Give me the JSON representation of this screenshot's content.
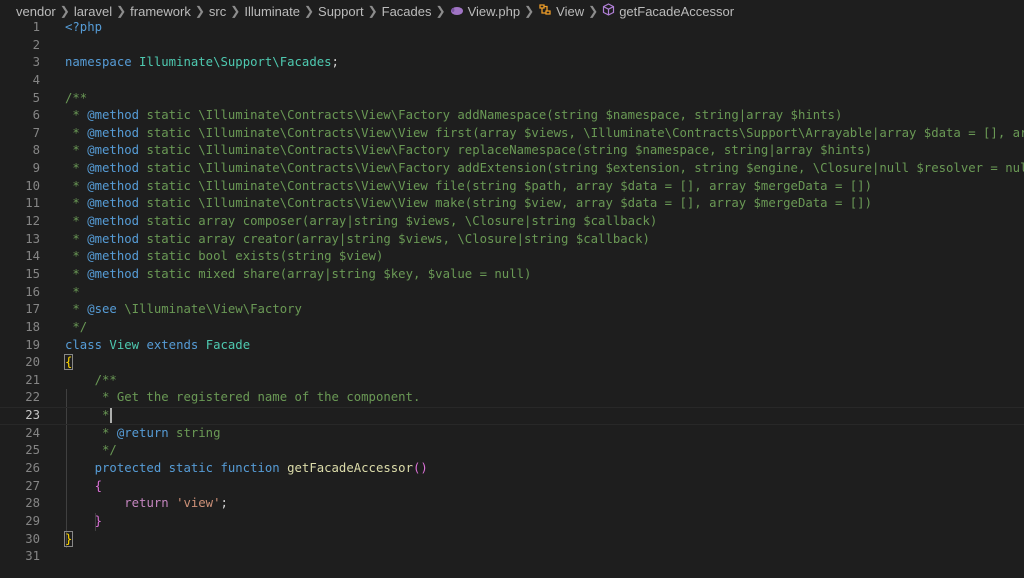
{
  "breadcrumb": {
    "items": [
      "vendor",
      "laravel",
      "framework",
      "src",
      "Illuminate",
      "Support",
      "Facades",
      "View.php",
      "View",
      "getFacadeAccessor"
    ],
    "separator": ">"
  },
  "editor": {
    "current_line": 23,
    "lines": [
      {
        "n": "1",
        "tokens": [
          {
            "t": "<?php",
            "c": "t-tag"
          }
        ]
      },
      {
        "n": "2",
        "tokens": []
      },
      {
        "n": "3",
        "tokens": [
          {
            "t": "namespace ",
            "c": "t-kw"
          },
          {
            "t": "Illuminate\\Support\\Facades",
            "c": "t-ns"
          },
          {
            "t": ";",
            "c": "t-pnc"
          }
        ]
      },
      {
        "n": "4",
        "tokens": []
      },
      {
        "n": "5",
        "tokens": [
          {
            "t": "/**",
            "c": "t-cmt"
          }
        ]
      },
      {
        "n": "6",
        "tokens": [
          {
            "t": " * ",
            "c": "t-cmt"
          },
          {
            "t": "@method",
            "c": "t-kw"
          },
          {
            "t": " static \\Illuminate\\Contracts\\View\\Factory addNamespace(string $namespace, string|array $hints)",
            "c": "t-cmt"
          }
        ]
      },
      {
        "n": "7",
        "tokens": [
          {
            "t": " * ",
            "c": "t-cmt"
          },
          {
            "t": "@method",
            "c": "t-kw"
          },
          {
            "t": " static \\Illuminate\\Contracts\\View\\View first(array $views, \\Illuminate\\Contracts\\Support\\Arrayable|array $data = [], array",
            "c": "t-cmt"
          }
        ]
      },
      {
        "n": "8",
        "tokens": [
          {
            "t": " * ",
            "c": "t-cmt"
          },
          {
            "t": "@method",
            "c": "t-kw"
          },
          {
            "t": " static \\Illuminate\\Contracts\\View\\Factory replaceNamespace(string $namespace, string|array $hints)",
            "c": "t-cmt"
          }
        ]
      },
      {
        "n": "9",
        "tokens": [
          {
            "t": " * ",
            "c": "t-cmt"
          },
          {
            "t": "@method",
            "c": "t-kw"
          },
          {
            "t": " static \\Illuminate\\Contracts\\View\\Factory addExtension(string $extension, string $engine, \\Closure|null $resolver = null)",
            "c": "t-cmt"
          }
        ]
      },
      {
        "n": "10",
        "tokens": [
          {
            "t": " * ",
            "c": "t-cmt"
          },
          {
            "t": "@method",
            "c": "t-kw"
          },
          {
            "t": " static \\Illuminate\\Contracts\\View\\View file(string $path, array $data = [], array $mergeData = [])",
            "c": "t-cmt"
          }
        ]
      },
      {
        "n": "11",
        "tokens": [
          {
            "t": " * ",
            "c": "t-cmt"
          },
          {
            "t": "@method",
            "c": "t-kw"
          },
          {
            "t": " static \\Illuminate\\Contracts\\View\\View make(string $view, array $data = [], array $mergeData = [])",
            "c": "t-cmt"
          }
        ]
      },
      {
        "n": "12",
        "tokens": [
          {
            "t": " * ",
            "c": "t-cmt"
          },
          {
            "t": "@method",
            "c": "t-kw"
          },
          {
            "t": " static array composer(array|string $views, \\Closure|string $callback)",
            "c": "t-cmt"
          }
        ]
      },
      {
        "n": "13",
        "tokens": [
          {
            "t": " * ",
            "c": "t-cmt"
          },
          {
            "t": "@method",
            "c": "t-kw"
          },
          {
            "t": " static array creator(array|string $views, \\Closure|string $callback)",
            "c": "t-cmt"
          }
        ]
      },
      {
        "n": "14",
        "tokens": [
          {
            "t": " * ",
            "c": "t-cmt"
          },
          {
            "t": "@method",
            "c": "t-kw"
          },
          {
            "t": " static bool exists(string $view)",
            "c": "t-cmt"
          }
        ]
      },
      {
        "n": "15",
        "tokens": [
          {
            "t": " * ",
            "c": "t-cmt"
          },
          {
            "t": "@method",
            "c": "t-kw"
          },
          {
            "t": " static mixed share(array|string $key, $value = null)",
            "c": "t-cmt"
          }
        ]
      },
      {
        "n": "16",
        "tokens": [
          {
            "t": " *",
            "c": "t-cmt"
          }
        ]
      },
      {
        "n": "17",
        "tokens": [
          {
            "t": " * ",
            "c": "t-cmt"
          },
          {
            "t": "@see",
            "c": "t-kw"
          },
          {
            "t": " \\Illuminate\\View\\Factory",
            "c": "t-cmt"
          }
        ]
      },
      {
        "n": "18",
        "tokens": [
          {
            "t": " */",
            "c": "t-cmt"
          }
        ]
      },
      {
        "n": "19",
        "tokens": [
          {
            "t": "class ",
            "c": "t-kw"
          },
          {
            "t": "View",
            "c": "t-cls"
          },
          {
            "t": " extends ",
            "c": "t-kw"
          },
          {
            "t": "Facade",
            "c": "t-cls"
          }
        ]
      },
      {
        "n": "20",
        "tokens": [
          {
            "t": "{",
            "c": "t-brk brace-hl"
          }
        ]
      },
      {
        "n": "21",
        "tokens": [
          {
            "t": "    /**",
            "c": "t-cmt"
          }
        ]
      },
      {
        "n": "22",
        "tokens": [
          {
            "t": "     * Get the registered name of the component.",
            "c": "t-cmt"
          }
        ]
      },
      {
        "n": "23",
        "tokens": [
          {
            "t": "     *",
            "c": "t-cmt"
          }
        ],
        "cursor": true
      },
      {
        "n": "24",
        "tokens": [
          {
            "t": "     * ",
            "c": "t-cmt"
          },
          {
            "t": "@return",
            "c": "t-kw"
          },
          {
            "t": " string",
            "c": "t-cmt"
          }
        ]
      },
      {
        "n": "25",
        "tokens": [
          {
            "t": "     */",
            "c": "t-cmt"
          }
        ]
      },
      {
        "n": "26",
        "tokens": [
          {
            "t": "    protected static function ",
            "c": "t-kw"
          },
          {
            "t": "getFacadeAccessor",
            "c": "t-fn"
          },
          {
            "t": "()",
            "c": "t-brk2"
          }
        ]
      },
      {
        "n": "27",
        "tokens": [
          {
            "t": "    ",
            "c": "t-pnc"
          },
          {
            "t": "{",
            "c": "t-brk2"
          }
        ]
      },
      {
        "n": "28",
        "tokens": [
          {
            "t": "        ",
            "c": "t-pnc"
          },
          {
            "t": "return ",
            "c": "t-ctl"
          },
          {
            "t": "'view'",
            "c": "t-str"
          },
          {
            "t": ";",
            "c": "t-pnc"
          }
        ]
      },
      {
        "n": "29",
        "tokens": [
          {
            "t": "    ",
            "c": "t-pnc"
          },
          {
            "t": "}",
            "c": "t-brk2"
          }
        ]
      },
      {
        "n": "30",
        "tokens": [
          {
            "t": "}",
            "c": "t-brk brace-hl"
          }
        ]
      },
      {
        "n": "31",
        "tokens": []
      }
    ]
  },
  "colors": {
    "background": "#1e1e1e",
    "comment": "#6a9955",
    "keyword": "#569cd6",
    "class": "#4ec9b0",
    "function": "#dcdcaa",
    "string": "#ce9178"
  }
}
